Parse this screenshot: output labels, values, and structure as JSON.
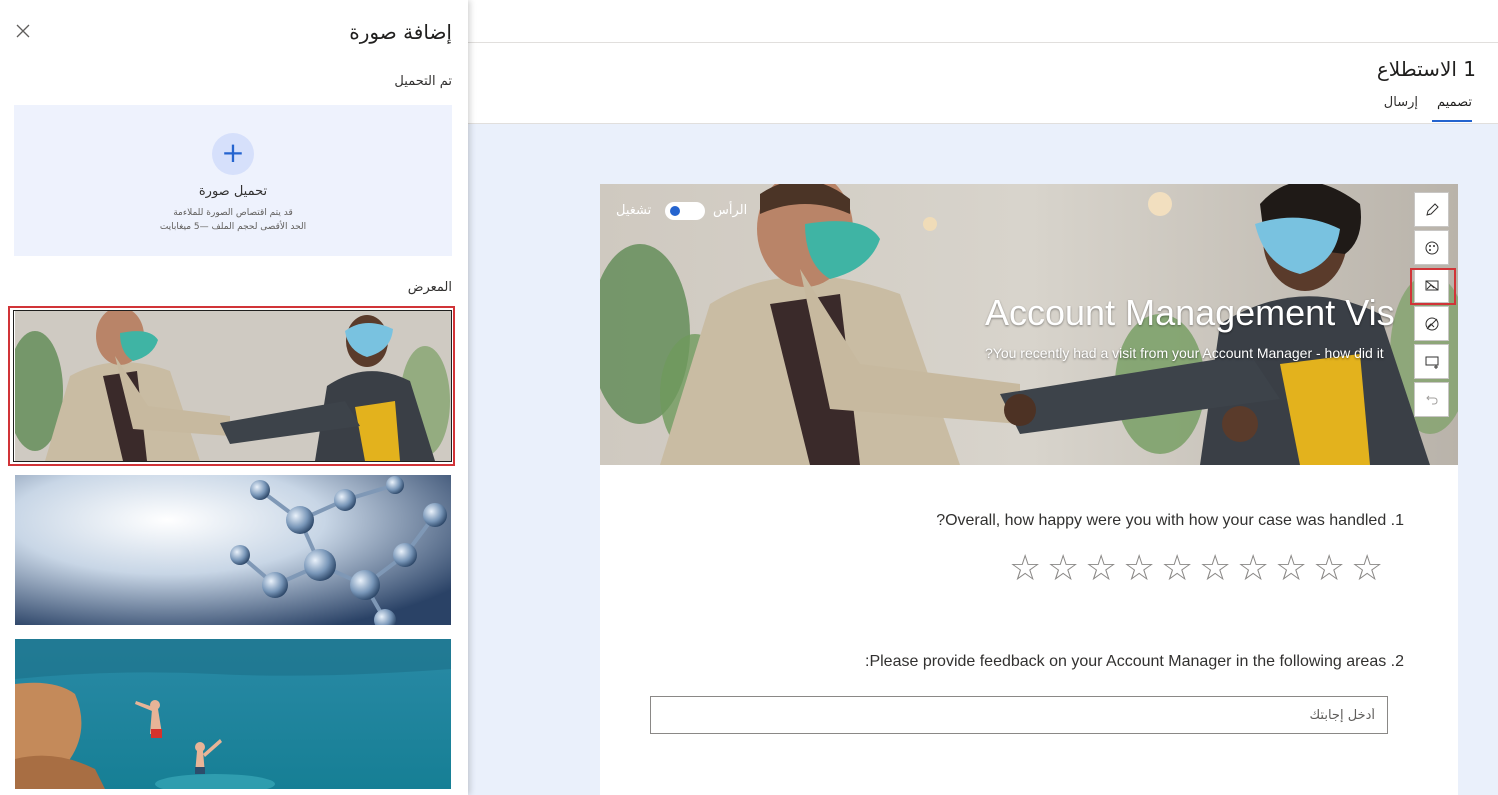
{
  "panel": {
    "title": "إضافة صورة",
    "uploaded_label": "تم التحميل",
    "upload": {
      "title": "تحميل صورة",
      "note_line1": "قد يتم اقتصاص الصورة للملاءمة",
      "note_line2": "الحد الأقصى لحجم الملف —5 ميغابايت"
    },
    "gallery_label": "المعرض",
    "gallery_items": [
      "business-people-elbow-greeting",
      "molecule-structure",
      "people-jumping-into-sea"
    ]
  },
  "survey": {
    "title": "1 الاستطلاع",
    "tabs": {
      "design": "تصميم",
      "send": "إرسال"
    }
  },
  "banner": {
    "header_label": "الرأس",
    "on_label": "تشغيل",
    "title": "Account Management Vis",
    "subtitle": "?You recently had a visit from your Account Manager - how did it"
  },
  "toolbar": [
    "edit-pencil-icon",
    "theme-palette-icon",
    "background-image-icon",
    "logo-icon",
    "add-section-icon",
    "undo-icon"
  ],
  "questions": [
    {
      "text": "?Overall, how happy were you with how your case was handled .1",
      "type": "rating",
      "stars": 10
    },
    {
      "text": ":Please provide feedback on your Account Manager in the following areas .2",
      "type": "text",
      "placeholder": "أدخل إجابتك"
    }
  ],
  "colors": {
    "accent": "#2564cf",
    "highlight": "#d13438",
    "canvas": "#eaf0fb"
  }
}
